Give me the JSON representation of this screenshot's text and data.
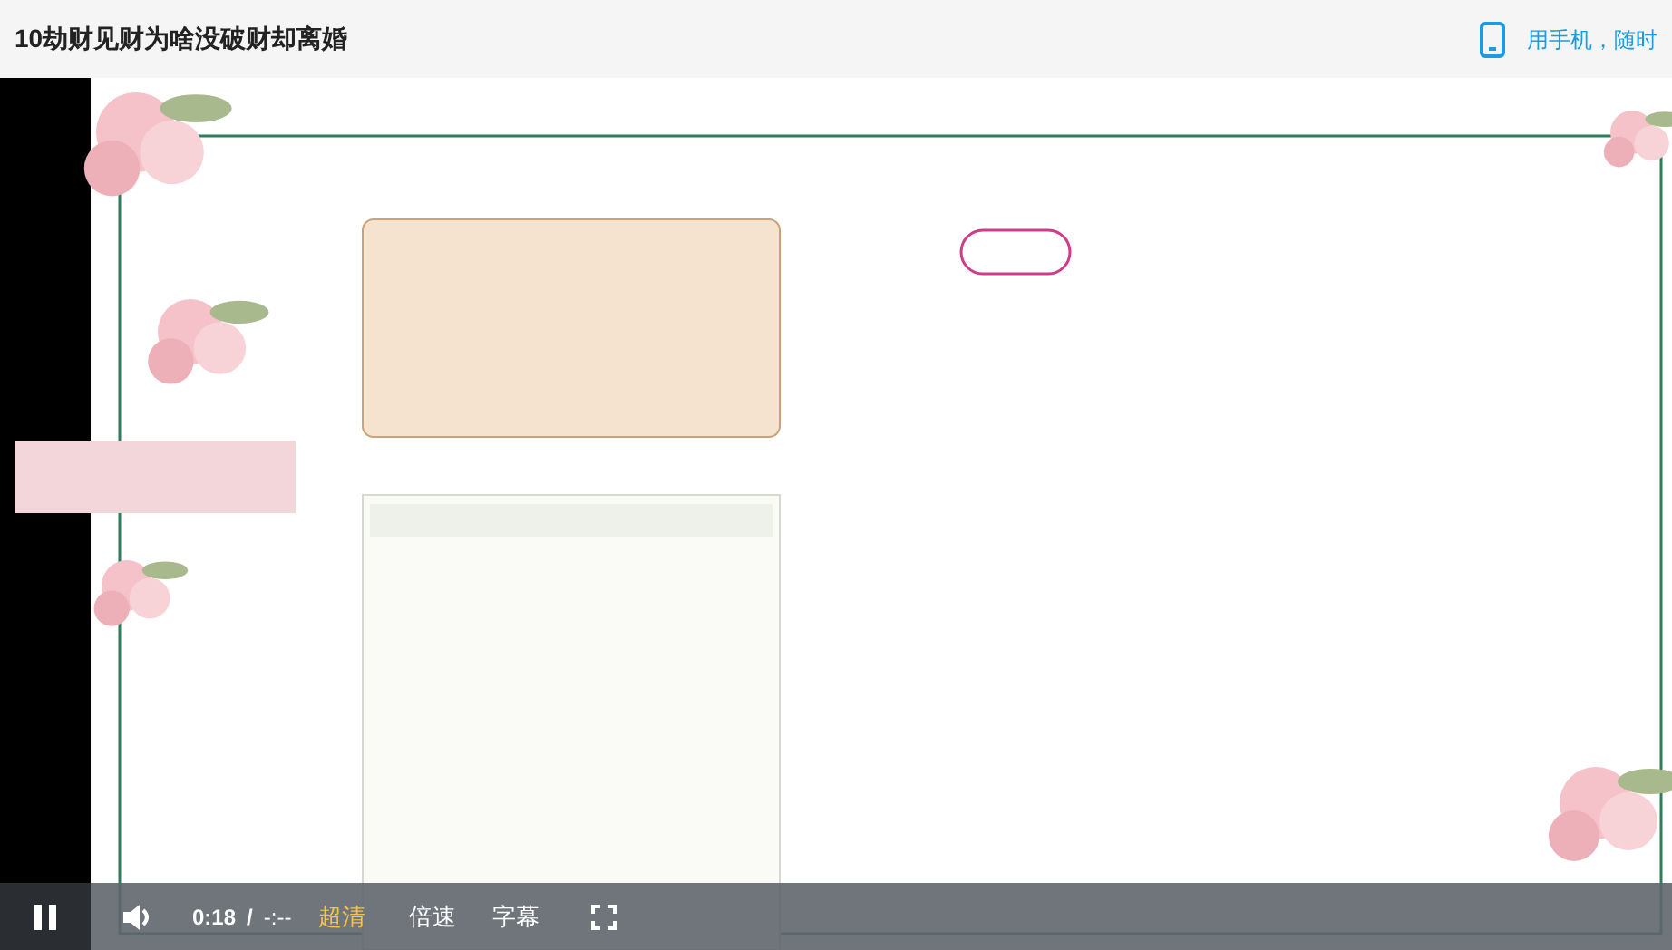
{
  "page": {
    "title": "10劫财见财为啥没破财却离婚",
    "mobile_link": "用手机，随时"
  },
  "video": {
    "kind": "picture",
    "playing": true,
    "current_time": "0:18",
    "separator": "/",
    "duration": "-:--",
    "quality": "超清",
    "speed": "倍速",
    "subtitles": "字幕"
  }
}
